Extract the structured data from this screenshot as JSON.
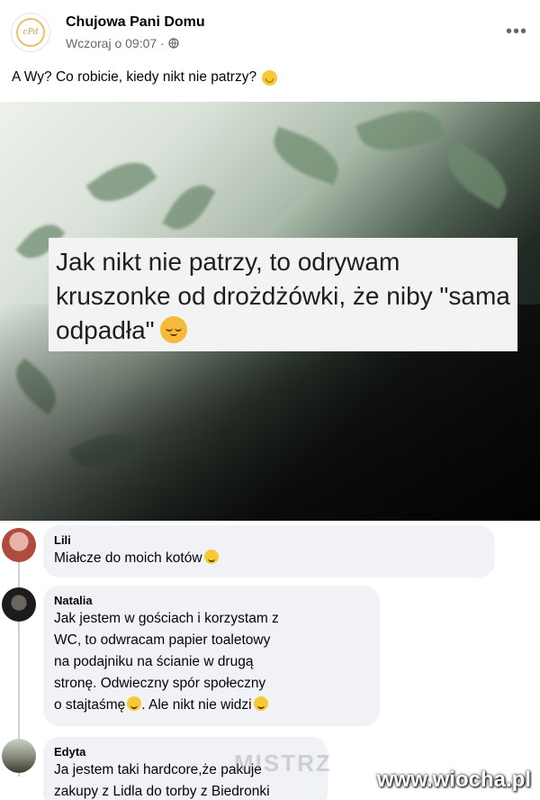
{
  "post": {
    "page_name": "Chujowa Pani Domu",
    "timestamp": "Wczoraj o 09:07 ·",
    "privacy_icon": "globe-icon",
    "more_label": "•••",
    "caption": "A Wy? Co robicie, kiedy nikt nie patrzy?",
    "caption_emoji": "slightly-smiling-emoji",
    "avatar_text": "cPd",
    "accent_color": "#e7c36d"
  },
  "image": {
    "quote": "Jak nikt nie patrzy, to odrywam kruszonke od drożdżówki, że niby \"sama odpadła\"",
    "quote_emoji": "relieved-face-emoji"
  },
  "comments": [
    {
      "author": "Lili",
      "text": "Miałcze do moich kotów",
      "emoji": "laughing-tears-emoji"
    },
    {
      "author": "Natalia",
      "text": "Jak jestem w gościach i korzystam z\nWC, to odwracam papier toaletowy\nna podajniku na ścianie w drugą\nstronę. Odwieczny spór społeczny\no stajtaśmę",
      "text_tail": ". Ale nikt nie widzi",
      "emoji": "grinning-emoji"
    },
    {
      "author": "Edyta",
      "text": "Ja jestem taki hardcore,że pakuje\nzakupy z Lidla do torby z Biedronki"
    }
  ],
  "watermark": "www.wiocha.pl",
  "ghost_watermark": "MISTRZ"
}
